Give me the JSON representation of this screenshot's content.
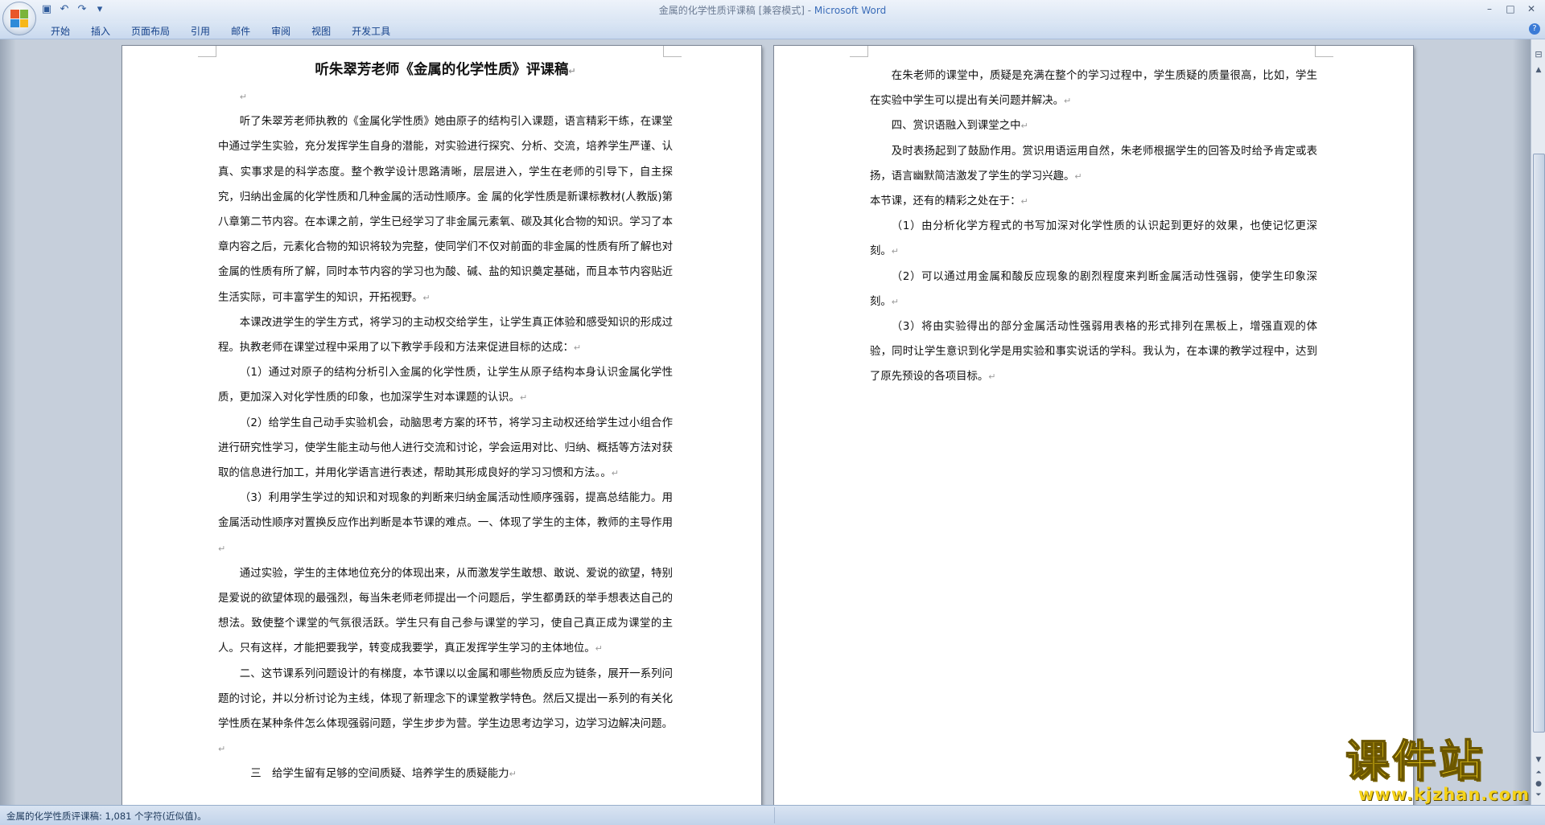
{
  "window": {
    "title": "金属的化学性质评课稿 [兼容模式] - ",
    "app_name": "Microsoft Word",
    "controls": [
      "–",
      "□",
      "✕"
    ]
  },
  "quick_access": [
    "save-icon",
    "undo-icon",
    "redo-icon",
    "customize-icon"
  ],
  "ribbon": {
    "tabs": [
      "开始",
      "插入",
      "页面布局",
      "引用",
      "邮件",
      "审阅",
      "视图",
      "开发工具"
    ]
  },
  "left_page": {
    "title": "听朱翠芳老师《金属的化学性质》评课稿",
    "paragraphs": [
      "",
      "听了朱翠芳老师执教的《金属化学性质》她由原子的结构引入课题，语言精彩干练，在课堂中通过学生实验，充分发挥学生自身的潜能，对实验进行探究、分析、交流，培养学生严谨、认真、实事求是的科学态度。整个教学设计思路清晰，层层进入，学生在老师的引导下，自主探究，归纳出金属的化学性质和几种金属的活动性顺序。金 属的化学性质是新课标教材(人教版)第八章第二节内容。在本课之前，学生已经学习了非金属元素氧、碳及其化合物的知识。学习了本章内容之后，元素化合物的知识将较为完整，使同学们不仅对前面的非金属的性质有所了解也对金属的性质有所了解，同时本节内容的学习也为酸、碱、盐的知识奠定基础，而且本节内容贴近生活实际，可丰富学生的知识，开拓视野。",
      "本课改进学生的学生方式，将学习的主动权交给学生，让学生真正体验和感受知识的形成过程。执教老师在课堂过程中采用了以下教学手段和方法来促进目标的达成：",
      "（1）通过对原子的结构分析引入金属的化学性质，让学生从原子结构本身认识金属化学性质，更加深入对化学性质的印象，也加深学生对本课题的认识。",
      "（2）给学生自己动手实验机会，动脑思考方案的环节，将学习主动权还给学生过小组合作进行研究性学习，使学生能主动与他人进行交流和讨论，学会运用对比、归纳、概括等方法对获取的信息进行加工，并用化学语言进行表述，帮助其形成良好的学习习惯和方法。。",
      "（3）利用学生学过的知识和对现象的判断来归纳金属活动性顺序强弱，提高总结能力。用金属活动性顺序对置换反应作出判断是本节课的难点。一、体现了学生的主体，教师的主导作用",
      "通过实验，学生的主体地位充分的体现出来，从而激发学生敢想、敢说、爱说的欲望，特别是爱说的欲望体现的最强烈，每当朱老师老师提出一个问题后，学生都勇跃的举手想表达自己的想法。致使整个课堂的气氛很活跃。学生只有自己参与课堂的学习，使自己真正成为课堂的主人。只有这样，才能把要我学，转变成我要学，真正发挥学生学习的主体地位。",
      "二、这节课系列问题设计的有梯度，本节课以以金属和哪些物质反应为链条，展开一系列问题的讨论，并以分析讨论为主线，体现了新理念下的课堂教学特色。然后又提出一系列的有关化学性质在某种条件怎么体现强弱问题，学生步步为营。学生边思考边学习，边学习边解决问题。",
      "三　给学生留有足够的空间质疑、培养学生的质疑能力"
    ]
  },
  "right_page": {
    "paragraphs": [
      "在朱老师的课堂中，质疑是充满在整个的学习过程中，学生质疑的质量很高，比如，学生在实验中学生可以提出有关问题并解决。",
      "四、赏识语融入到课堂之中",
      "及时表扬起到了鼓励作用。赏识用语运用自然，朱老师根据学生的回答及时给予肯定或表扬，语言幽默简洁激发了学生的学习兴趣。",
      "本节课，还有的精彩之处在于：",
      "（1）由分析化学方程式的书写加深对化学性质的认识起到更好的效果，也使记忆更深刻。",
      "（2）可以通过用金属和酸反应现象的剧烈程度来判断金属活动性强弱，使学生印象深刻。",
      "（3）将由实验得出的部分金属活动性强弱用表格的形式排列在黑板上，增强直观的体验，同时让学生意识到化学是用实验和事实说话的学科。我认为，在本课的教学过程中，达到了原先预设的各项目标。"
    ]
  },
  "paragraph_mark": "↵",
  "status_bar": {
    "text": "金属的化学性质评课稿: 1,081 个字符(近似值)。"
  },
  "watermark": {
    "text": "课件站",
    "url": "www.kjzhan.com"
  }
}
